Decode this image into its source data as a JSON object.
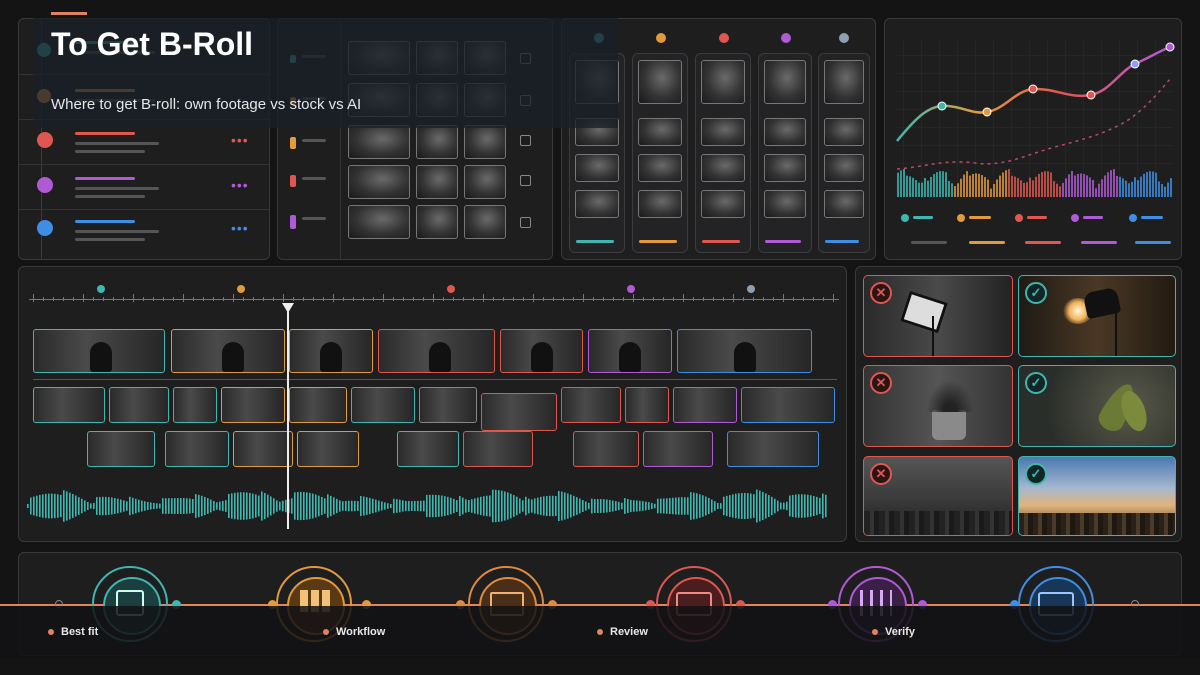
{
  "header": {
    "title": "To Get B-Roll",
    "subtitle": "Where to get B-roll: own footage vs stock vs AI"
  },
  "colors": {
    "teal": "#3fb7b0",
    "orange": "#e39a3d",
    "red": "#e0574f",
    "purple": "#b05ad6",
    "blue": "#3e8ee6",
    "accent": "#e0845f"
  },
  "comparison": {
    "rejected_icon": "close-icon",
    "approved_icon": "check-icon",
    "reject_symbol": "✕",
    "approve_symbol": "✓"
  },
  "workflow": {
    "steps": [
      {
        "icon": "document-icon"
      },
      {
        "icon": "grid-icon"
      },
      {
        "icon": "image-icon"
      },
      {
        "icon": "video-icon"
      },
      {
        "icon": "sliders-icon"
      },
      {
        "icon": "monitor-icon"
      }
    ],
    "captions": [
      "Best fit",
      "Workflow",
      "Review",
      "Verify"
    ]
  }
}
